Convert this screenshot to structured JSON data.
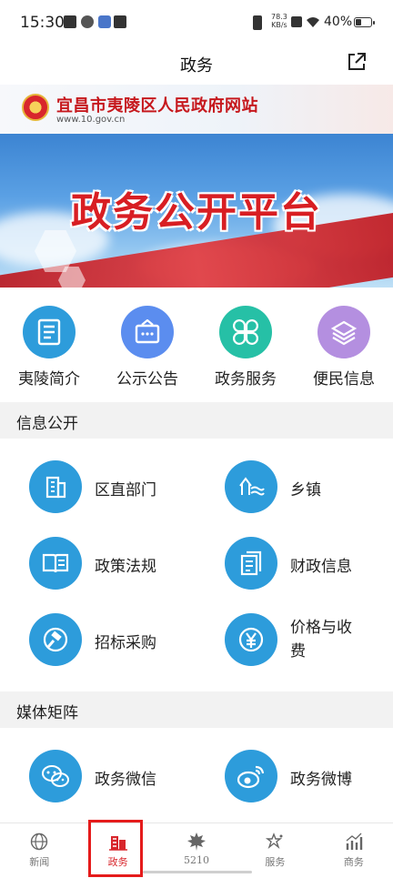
{
  "status_bar": {
    "time": "15:30",
    "network_speed_value": "78.3",
    "network_speed_unit": "KB/s",
    "battery_percent": "40%",
    "battery_level": 0.4
  },
  "header": {
    "title": "政务",
    "share_icon": "share-icon"
  },
  "banner": {
    "site_name": "宜昌市夷陵区人民政府网站",
    "site_url": "www.10.gov.cn",
    "headline": "政务公开平台"
  },
  "quick_menu": [
    {
      "label": "夷陵简介",
      "icon": "document-icon",
      "color": "#2d9cdb"
    },
    {
      "label": "公示公告",
      "icon": "notice-board-icon",
      "color": "#5b8def"
    },
    {
      "label": "政务服务",
      "icon": "clover-grid-icon",
      "color": "#26c0a6"
    },
    {
      "label": "便民信息",
      "icon": "layers-icon",
      "color": "#b48fe0"
    }
  ],
  "sections": {
    "info_public": "信息公开",
    "media_matrix": "媒体矩阵"
  },
  "info_items": [
    {
      "label": "区直部门",
      "icon": "building-icon"
    },
    {
      "label": "乡镇",
      "icon": "town-icon"
    },
    {
      "label": "政策法规",
      "icon": "open-book-icon"
    },
    {
      "label": "财政信息",
      "icon": "files-icon"
    },
    {
      "label": "招标采购",
      "icon": "gavel-icon"
    },
    {
      "label": "价格与收费",
      "icon": "yuan-icon"
    }
  ],
  "media_items": [
    {
      "label": "政务微信",
      "icon": "wechat-icon"
    },
    {
      "label": "政务微博",
      "icon": "weibo-icon"
    }
  ],
  "bottom_nav": [
    {
      "label": "新闻",
      "icon": "globe-icon",
      "active": false
    },
    {
      "label": "政务",
      "icon": "government-building-icon",
      "active": true
    },
    {
      "label": "5210",
      "icon": "maple-leaf-icon",
      "active": false
    },
    {
      "label": "服务",
      "icon": "star-icon",
      "active": false
    },
    {
      "label": "商务",
      "icon": "bar-chart-icon",
      "active": false
    }
  ],
  "colors": {
    "accent_red": "#d8262c",
    "icon_blue": "#2d9cdb",
    "section_bg": "#f2f2f2"
  }
}
